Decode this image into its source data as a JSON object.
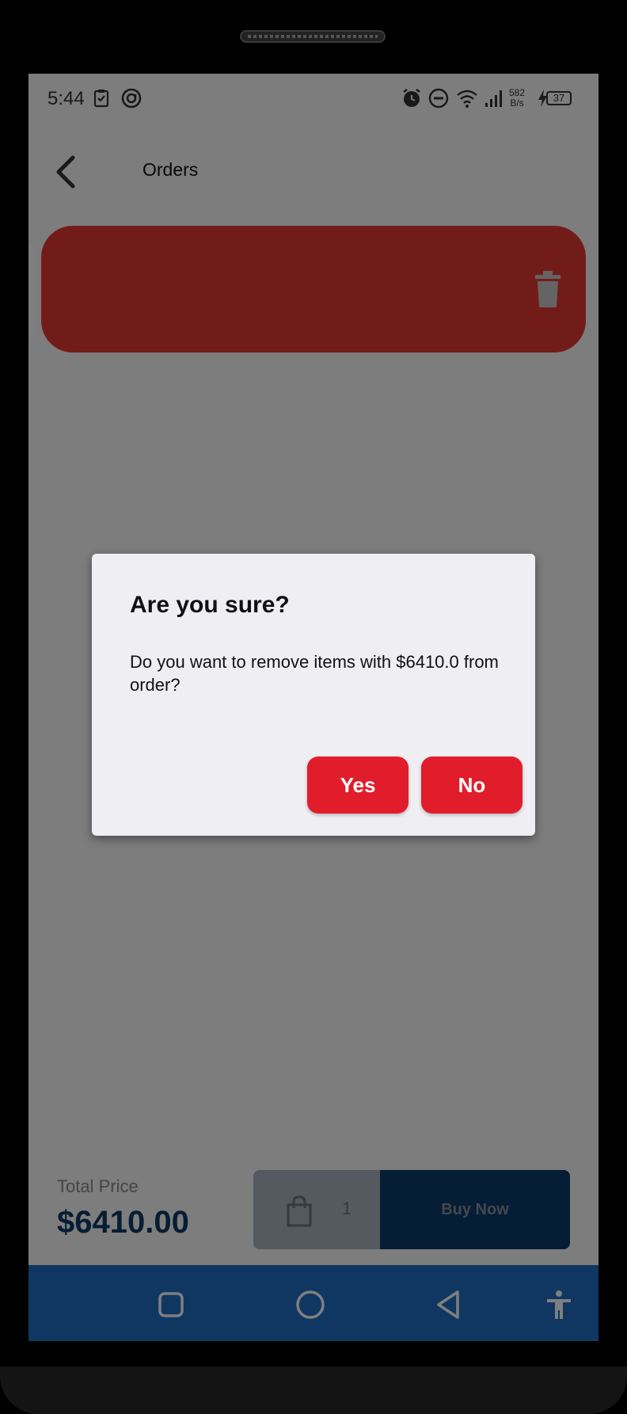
{
  "status_bar": {
    "time": "5:44",
    "net_speed_value": "582",
    "net_speed_unit": "B/s",
    "battery": "37"
  },
  "appbar": {
    "title": "Orders"
  },
  "order_summary": {
    "total_label": "Total Price",
    "total_value": "$6410.00",
    "quantity": "1",
    "buy_label": "Buy Now"
  },
  "dialog": {
    "title": "Are you sure?",
    "message": "Do you want to remove items with $6410.0 from order?",
    "yes_label": "Yes",
    "no_label": "No"
  },
  "colors": {
    "accent": "#e11d2b",
    "swipe_delete": "#e53935",
    "primary_dark": "#0a3a6b",
    "nav_bar": "#1f6fc4",
    "dialog_bg": "#efeef2"
  },
  "icons": [
    "clipboard-check-icon",
    "at-sign-icon",
    "alarm-icon",
    "do-not-disturb-icon",
    "wifi-icon",
    "signal-icon",
    "charging-icon",
    "battery-icon",
    "back-arrow-icon",
    "trash-icon",
    "shopping-bag-icon",
    "nav-recents-icon",
    "nav-home-icon",
    "nav-back-icon",
    "accessibility-icon"
  ]
}
